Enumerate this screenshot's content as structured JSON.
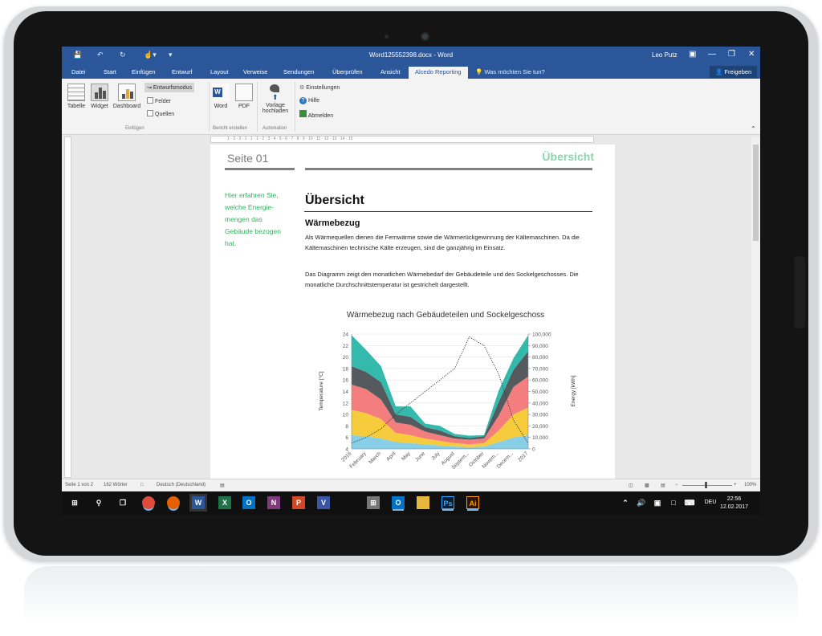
{
  "window": {
    "title": "Word125552398.docx  -  Word",
    "user": "Leo Putz"
  },
  "tabs": [
    "Datei",
    "Start",
    "Einfügen",
    "Entwurf",
    "Layout",
    "Verweise",
    "Sendungen",
    "Überprüfen",
    "Ansicht",
    "Alcedo Reporting"
  ],
  "active_tab": "Alcedo Reporting",
  "tell_me": "Was möchten Sie tun?",
  "share_label": "Freigeben",
  "ribbon": {
    "einfuegen": {
      "tabelle": "Tabelle",
      "widget": "Widget",
      "dashboard": "Dashboard",
      "entwurfsmodus": "Entwurfsmodus",
      "felder": "Felder",
      "quellen": "Quellen",
      "group": "Einfügen"
    },
    "bericht": {
      "word": "Word",
      "pdf": "PDF",
      "group": "Bericht erstellen"
    },
    "automation": {
      "vorlage1": "Vorlage",
      "vorlage2": "hochladen",
      "group": "Automation"
    },
    "misc": {
      "einstellungen": "Einstellungen",
      "hilfe": "Hilfe",
      "abmelden": "Abmelden"
    }
  },
  "ruler_text": "1 · 3 · 2 · 1 · 1 · 1 · 2 · 3 · 4 · 5 · 6 · 7 · 8 · 9 · 10 · 11 · 12 · 13 · 14 · 15",
  "page": {
    "seite": "Seite 01",
    "header_right": "Übersicht",
    "side_note": [
      "Hier erfahren Sie,",
      "welche Energie-",
      "mengen das",
      "Gebäude bezogen",
      "hat."
    ],
    "heading": "Übersicht",
    "subheading": "Wärmebezug",
    "para1": "Als Wärmequellen dienen die Fernwärme sowie die Wärmerückgewinnung der Kältemaschinen. Da die Kältemaschinen technische Kälte erzeugen, sind die ganzjährig im Einsatz.",
    "para2": "Das Diagramm zeigt den monatlichen Wärmebedarf der Gebäudeteile und des Sockelgeschosses. Die monatliche Durchschnittstemperatur ist gestrichelt dargestellt."
  },
  "chart_data": {
    "type": "area",
    "title": "Wärmebezug nach Gebäudeteilen und Sockelgeschoss",
    "x": [
      "2016",
      "February",
      "March",
      "April",
      "May",
      "June",
      "July",
      "August",
      "Septem...",
      "October",
      "Novem...",
      "Decem...",
      "2017"
    ],
    "ylabel_left": "Temperature [°C]",
    "ylabel_right": "Energy [kWh]",
    "ylim_left": [
      4,
      24
    ],
    "ylim_right": [
      0,
      100000
    ],
    "left_ticks": [
      4,
      6,
      8,
      10,
      12,
      14,
      16,
      18,
      20,
      22,
      24
    ],
    "right_ticks": [
      "0",
      "10,000",
      "20,000",
      "30,000",
      "40,000",
      "50,000",
      "60,000",
      "70,000",
      "80,000",
      "90,000",
      "100,000"
    ],
    "stacked": true,
    "series": [
      {
        "color": "#86cfe6",
        "values": [
          12000,
          11000,
          9000,
          6000,
          5000,
          4000,
          3000,
          2000,
          1500,
          2000,
          6000,
          10000,
          12000
        ]
      },
      {
        "color": "#f6cb3c",
        "values": [
          22000,
          20000,
          17000,
          8000,
          7000,
          5000,
          4000,
          3000,
          2500,
          3000,
          10000,
          20000,
          24000
        ]
      },
      {
        "color": "#f47e7e",
        "values": [
          22000,
          21000,
          17000,
          9000,
          9000,
          6000,
          5000,
          4000,
          4000,
          4000,
          13000,
          24000,
          27000
        ]
      },
      {
        "color": "#555a5e",
        "values": [
          16000,
          15000,
          15000,
          7000,
          7000,
          4000,
          4000,
          2000,
          1500,
          2000,
          12000,
          15000,
          22000
        ]
      },
      {
        "color": "#34b9ad",
        "values": [
          27000,
          19000,
          14000,
          7000,
          9000,
          3000,
          4000,
          2000,
          2000,
          1000,
          10000,
          10000,
          14000
        ]
      }
    ],
    "temperature_line": {
      "style": "dotted",
      "color": "#333333",
      "values": [
        5,
        6,
        7.5,
        10,
        12,
        14,
        16,
        18,
        23.5,
        22,
        17,
        9,
        5
      ]
    }
  },
  "status": {
    "page": "Seite 1 von 2",
    "words": "162 Wörter",
    "lang": "Deutsch (Deutschland)",
    "zoom": "100%"
  },
  "taskbar": {
    "lang": "DEU",
    "time": "22:56",
    "date": "12.02.2017"
  }
}
